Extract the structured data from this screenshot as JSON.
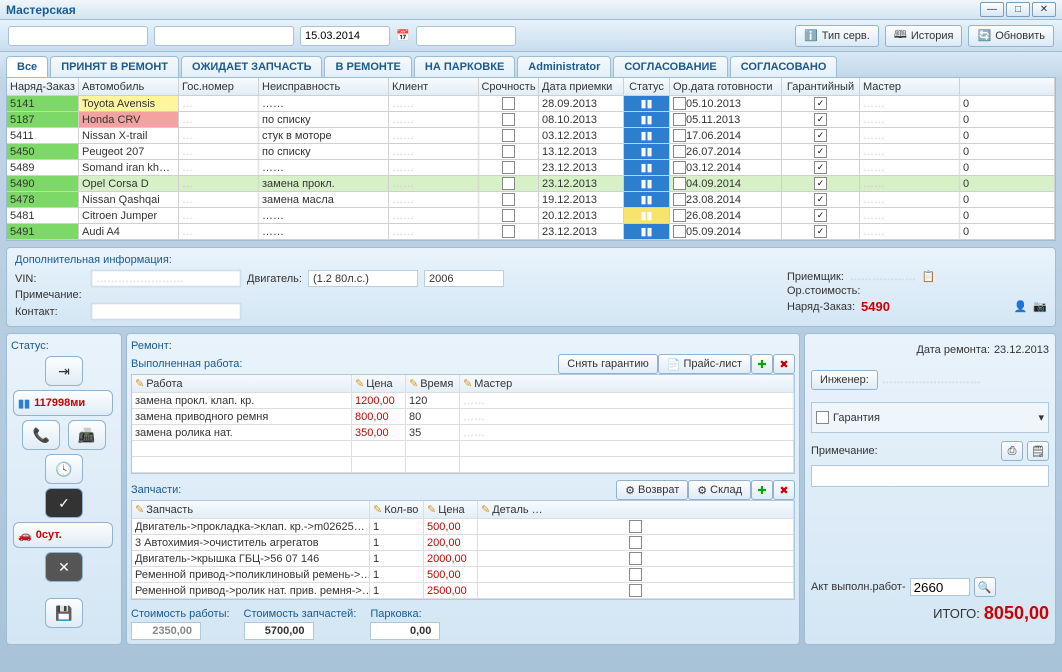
{
  "window": {
    "title": "Мастерская"
  },
  "toolbar": {
    "date": "15.03.2014",
    "type_service": "Тип серв.",
    "history": "История",
    "refresh": "Обновить"
  },
  "tabs": [
    "Все",
    "ПРИНЯТ В РЕМОНТ",
    "ОЖИДАЕТ ЗАПЧАСТЬ",
    "В РЕМОНТЕ",
    "НА ПАРКОВКЕ",
    "Administrator",
    "СОГЛАСОВАНИЕ",
    "СОГЛАСОВАНО"
  ],
  "grid": {
    "cols": [
      "Наряд-Заказ",
      "Автомобиль",
      "Гос.номер",
      "Неисправность",
      "Клиент",
      "Срочность",
      "Дата приемки",
      "Статус",
      "Ор.дата готовности",
      "Гарантийный",
      "Мастер"
    ],
    "rows": [
      {
        "order": "5141",
        "order_c": "cell-green",
        "car": "Toyota Avensis",
        "car_c": "cell-yellow",
        "plate": "…",
        "fault": "……",
        "date": "28.09.2013",
        "status_c": "cell-blue",
        "ready": "05.10.2013",
        "warranty": true
      },
      {
        "order": "5187",
        "order_c": "cell-green",
        "car": "Honda CRV",
        "car_c": "cell-red",
        "plate": "…",
        "fault": "по списку",
        "date": "08.10.2013",
        "status_c": "cell-blue",
        "ready": "05.11.2013",
        "warranty": true
      },
      {
        "order": "5411",
        "order_c": "",
        "car": "Nissan X-trail",
        "plate": "…",
        "fault": "стук в моторе",
        "date": "03.12.2013",
        "status_c": "cell-blue",
        "ready": "17.06.2014",
        "warranty": true
      },
      {
        "order": "5450",
        "order_c": "cell-green",
        "car": "Peugeot 207",
        "plate": "…",
        "fault": "по списку",
        "date": "13.12.2013",
        "status_c": "cell-blue",
        "ready": "26.07.2014",
        "warranty": true
      },
      {
        "order": "5489",
        "order_c": "",
        "car": "Somand iran kh…",
        "plate": "…",
        "fault": "……",
        "date": "23.12.2013",
        "status_c": "cell-blue",
        "ready": "03.12.2014",
        "warranty": true
      },
      {
        "order": "5490",
        "order_c": "cell-green",
        "car": "Opel Corsa D",
        "plate": "…",
        "fault": "замена прокл.",
        "date": "23.12.2013",
        "status_c": "cell-blue",
        "ready": "04.09.2014",
        "warranty": true,
        "hl": true
      },
      {
        "order": "5478",
        "order_c": "cell-green",
        "car": "Nissan Qashqai",
        "plate": "…",
        "fault": "замена масла",
        "date": "19.12.2013",
        "status_c": "cell-blue",
        "ready": "23.08.2014",
        "warranty": true
      },
      {
        "order": "5481",
        "order_c": "",
        "car": "Citroen Jumper",
        "plate": "…",
        "fault": "……",
        "date": "20.12.2013",
        "status_c": "cell-yellow",
        "ready": "26.08.2014",
        "warranty": true
      },
      {
        "order": "5491",
        "order_c": "cell-green",
        "car": "Audi A4",
        "plate": "…",
        "fault": "……",
        "date": "23.12.2013",
        "status_c": "cell-blue",
        "ready": "05.09.2014",
        "warranty": true
      }
    ]
  },
  "info": {
    "title": "Дополнительная информация:",
    "vin_label": "VIN:",
    "vin": "……………………",
    "engine_label": "Двигатель:",
    "engine": "(1.2 80л.с.)",
    "year": "2006",
    "note_label": "Примечание:",
    "contact_label": "Контакт:",
    "receiver_label": "Приемщик:",
    "receiver": "………………",
    "orcost_label": "Ор.стоимость:",
    "order_label": "Наряд-Заказ:",
    "order_val": "5490"
  },
  "status": {
    "title": "Статус:",
    "mileage": "117998ми",
    "days": "0сут."
  },
  "repair": {
    "title": "Ремонт:",
    "done_title": "Выполненная работа:",
    "warranty_btn": "Снять гарантию",
    "price_list": "Прайс-лист",
    "date_label": "Дата ремонта:",
    "date": "23.12.2013",
    "engineer_label": "Инженер:",
    "engineer": "………………………",
    "work_cols": [
      "Работа",
      "Цена",
      "Время",
      "Мастер"
    ],
    "works": [
      {
        "name": "замена прокл. клап. кр.",
        "price": "1200,00",
        "time": "120"
      },
      {
        "name": "замена приводного ремня",
        "price": "800,00",
        "time": "80"
      },
      {
        "name": "замена ролика нат.",
        "price": "350,00",
        "time": "35"
      }
    ],
    "parts_title": "Запчасти:",
    "return_btn": "Возврат",
    "warehouse_btn": "Склад",
    "part_cols": [
      "Запчасть",
      "Кол-во",
      "Цена",
      "Деталь …"
    ],
    "parts": [
      {
        "name": "Двигатель->прокладка->клап. кр.->m02625…",
        "qty": "1",
        "price": "500,00"
      },
      {
        "name": "3 Автохимия->очиститель агрегатов",
        "qty": "1",
        "price": "200,00"
      },
      {
        "name": "Двигатель->крышка ГБЦ->56 07 146",
        "qty": "1",
        "price": "2000,00"
      },
      {
        "name": "Ременной привод->поликлиновый ремень->…",
        "qty": "1",
        "price": "500,00"
      },
      {
        "name": "Ременной привод->ролик нат. прив. ремня->…",
        "qty": "1",
        "price": "2500,00"
      }
    ]
  },
  "right": {
    "warranty_label": "Гарантия",
    "note_label": "Примечание:",
    "act_label": "Акт выполн.работ-",
    "act_val": "2660"
  },
  "footer": {
    "work_cost_label": "Стоимость работы:",
    "work_cost": "2350,00",
    "parts_cost_label": "Стоимость запчастей:",
    "parts_cost": "5700,00",
    "parking_label": "Парковка:",
    "parking": "0,00",
    "total_label": "ИТОГО:",
    "total": "8050,00"
  }
}
